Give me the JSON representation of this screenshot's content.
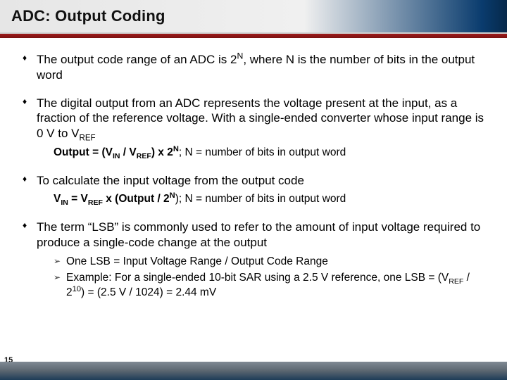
{
  "title": "ADC: Output Coding",
  "page_number": "15",
  "bullets": {
    "b1_pre": "The output code range of an ADC is 2",
    "b1_sup": "N",
    "b1_post": ", where N is the number of bits in the output word",
    "b2_pre": "The digital output from an ADC represents the voltage present at the input, as a fraction of the reference voltage. With a single-ended converter whose input range is 0 V to V",
    "b2_sub": "REF",
    "f1_a": "Output = (V",
    "f1_in": "IN",
    "f1_b": " / V",
    "f1_ref": "REF",
    "f1_c": ") x 2",
    "f1_n": "N",
    "f1_tail": "; N = number of bits in output word",
    "b3": "To calculate the input voltage from the output code",
    "f2_a": "V",
    "f2_in": "IN",
    "f2_b": " =  V",
    "f2_ref": "REF",
    "f2_c": "  x (Output / 2",
    "f2_n": "N",
    "f2_tail": "); N = number of bits in output word",
    "b4": "The term “LSB” is commonly used to refer to the amount of input voltage required to produce a single-code change at the output",
    "s1": "One LSB = Input Voltage Range / Output Code Range",
    "s2_a": "Example: For a single-ended 10-bit SAR using a 2.5 V reference, one LSB = (V",
    "s2_ref": "REF",
    "s2_b": " / 2",
    "s2_exp": "10",
    "s2_c": ") = (2.5 V / 1024) = 2.44 mV"
  }
}
